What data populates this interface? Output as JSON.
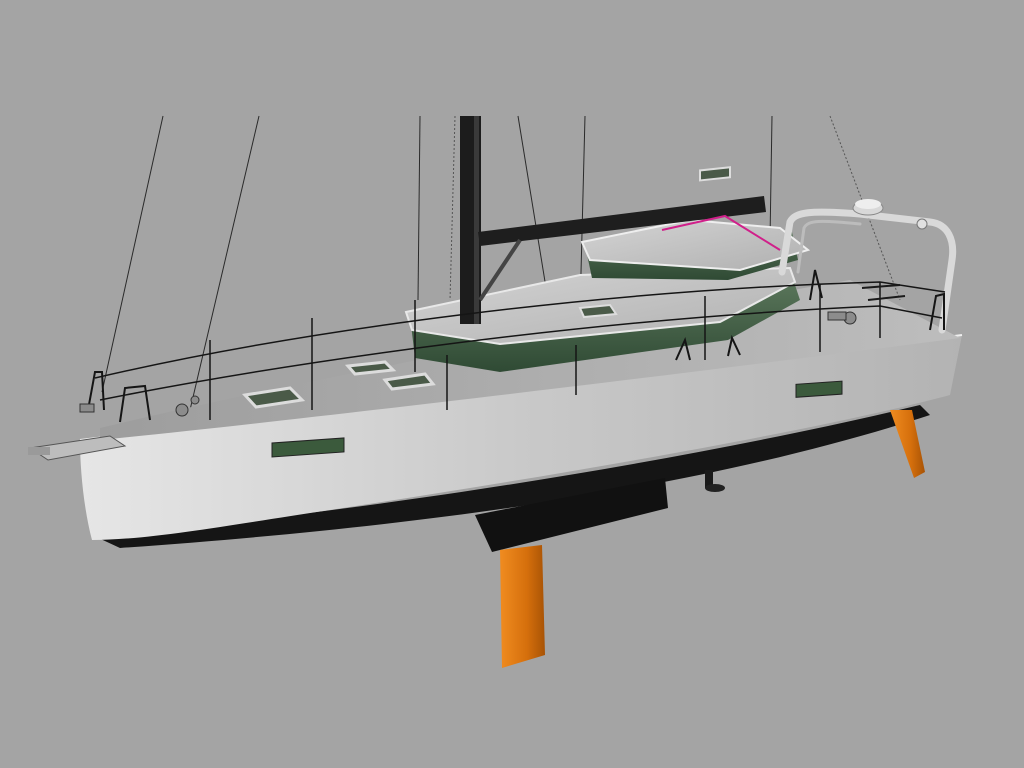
{
  "scene": {
    "subject": "sailboat-render",
    "colors": {
      "background": "#a4a4a4",
      "hull": "#c8c8c8",
      "deck": "#b9b9b9",
      "bottom": "#151515",
      "foils": "#e07a12",
      "glass": "#3f5a3f",
      "mast": "#1c1c1c"
    }
  }
}
